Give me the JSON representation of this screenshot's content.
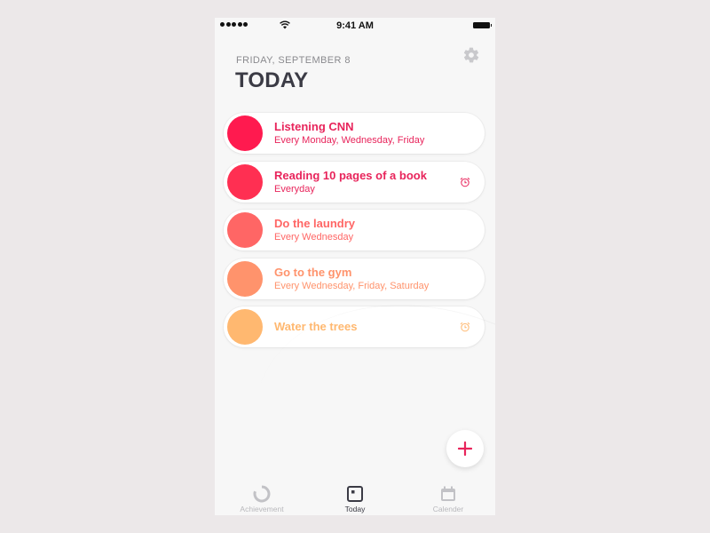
{
  "status_bar": {
    "time": "9:41 AM"
  },
  "header": {
    "date": "FRIDAY, SEPTEMBER 8",
    "title": "TODAY",
    "settings_icon": "gear-icon"
  },
  "habits": [
    {
      "title": "Listening CNN",
      "schedule": "Every Monday, Wednesday, Friday",
      "color": "#ff1a4f",
      "alarm": false
    },
    {
      "title": "Reading 10 pages of a book",
      "schedule": "Everyday",
      "color": "#ff2f52",
      "alarm": true
    },
    {
      "title": "Do the laundry",
      "schedule": "Every Wednesday",
      "color": "#ff6665",
      "alarm": false
    },
    {
      "title": "Go to the gym",
      "schedule": "Every Wednesday, Friday, Saturday",
      "color": "#ff936c",
      "alarm": false
    },
    {
      "title": "Water the trees",
      "schedule": "",
      "color": "#ffb870",
      "alarm": true
    }
  ],
  "colors": {
    "accent": "#e8245b",
    "title_dark": "#3b3b45",
    "inactive": "#b8b8bc"
  },
  "fab": {
    "icon": "plus-icon"
  },
  "tabs": [
    {
      "label": "Achievement",
      "icon": "progress-ring-icon",
      "active": false
    },
    {
      "label": "Today",
      "icon": "day-square-icon",
      "active": true
    },
    {
      "label": "Calender",
      "icon": "calendar-icon",
      "active": false
    }
  ]
}
